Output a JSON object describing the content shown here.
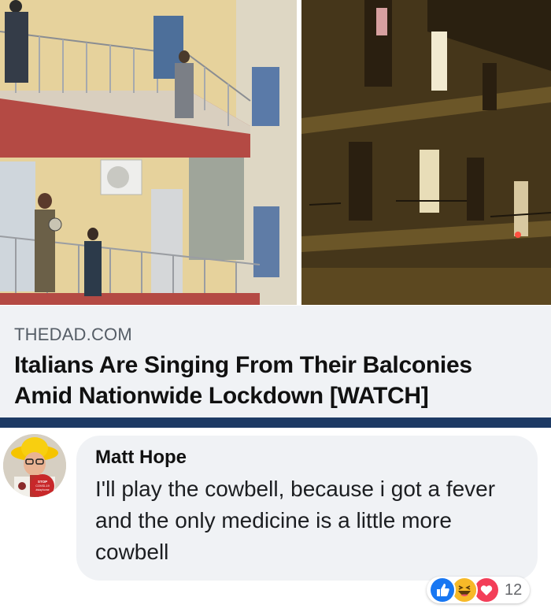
{
  "link_preview": {
    "domain": "THEDAD.COM",
    "title": "Italians Are Singing From Their Balconies Amid Nationwide Lockdown [WATCH]"
  },
  "avatar": {
    "badge_line1": "STOP",
    "badge_line2": "COVID-19",
    "badge_line3": "#stayhome"
  },
  "comment": {
    "author": "Matt Hope",
    "text": "I'll play the cowbell, because i got a fever and the only medicine is a little more cowbell"
  },
  "reactions": {
    "icons": [
      "like-icon",
      "haha-icon",
      "love-icon"
    ],
    "count": "12"
  },
  "colors": {
    "accent_bar": "#1d3a64",
    "link_meta_bg": "#f0f2f5",
    "like": "#1877f2",
    "haha": "#f7b928",
    "love": "#f33e58"
  }
}
